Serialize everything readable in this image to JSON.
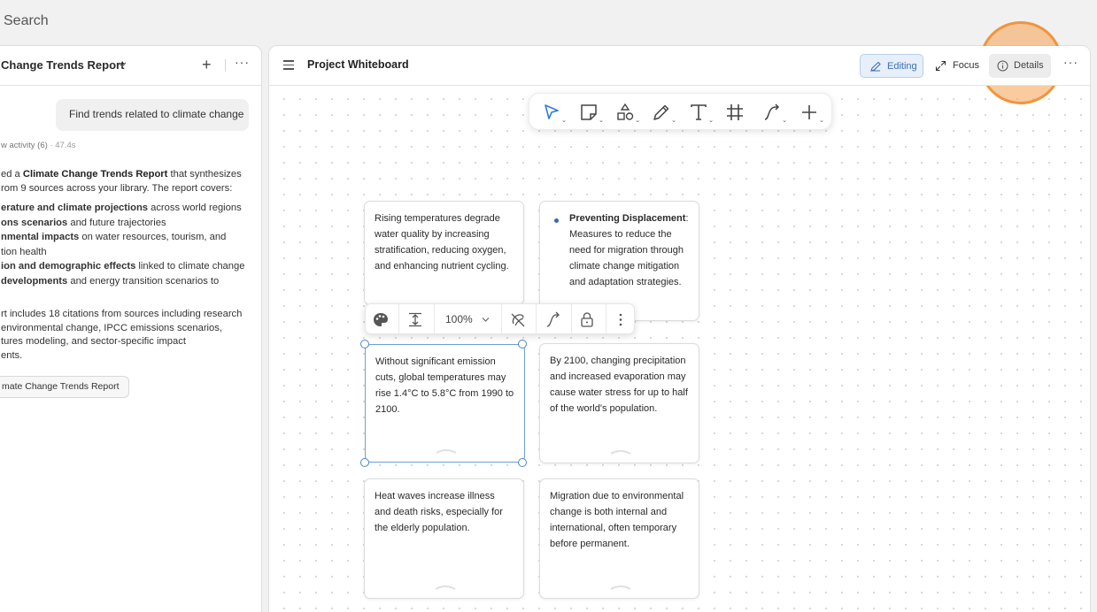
{
  "topbar": {
    "search_label": "Search"
  },
  "left_panel": {
    "report_title": "Change Trends Report",
    "user_message": "Find trends related to climate change",
    "activity": {
      "label": "w activity (6)",
      "time": " · 47.4s"
    },
    "answer_lines": [
      [
        "ed a ",
        "Climate Change Trends Report",
        " that synthesizes"
      ],
      [
        "rom 9 sources across your library. The report covers:",
        "",
        ""
      ]
    ],
    "bullets": [
      [
        "erature and climate projections",
        " across world regions"
      ],
      [
        "ons scenarios",
        " and future trajectories"
      ],
      [
        "nmental impacts",
        " on water resources, tourism, and"
      ],
      [
        "",
        "tion health"
      ],
      [
        "ion and demographic effects",
        " linked to climate change"
      ],
      [
        "developments",
        " and energy transition scenarios to"
      ]
    ],
    "citations": [
      "rt includes 18 citations from sources including research",
      " environmental change, IPCC emissions scenarios,",
      "tures modeling, and sector-specific impact",
      "ents."
    ],
    "report_chip": "mate Change Trends Report"
  },
  "main": {
    "title": "Project Whiteboard",
    "editing_label": "Editing",
    "focus_label": "Focus",
    "details_label": "Details",
    "zoom": "100%",
    "cards": [
      {
        "text": "Rising temperatures degrade water quality by increasing stratification, reducing oxygen, and enhancing nutrient cycling."
      },
      {
        "bold": "Preventing Displacement",
        "text": ": Measures to reduce the need for migration through climate change mitigation and adaptation strategies."
      },
      {
        "text": "Without significant emission cuts, global temperatures may rise 1.4°C to 5.8°C from 1990 to 2100."
      },
      {
        "text": "By 2100, changing precipitation and increased evaporation may cause water stress for up to half of the world's population."
      },
      {
        "text": "Heat waves increase illness and death risks, especially for the elderly population."
      },
      {
        "text": "Migration due to environmental change is both internal and international, often temporary before permanent."
      }
    ]
  },
  "colors": {
    "accent": "#4a86c8",
    "highlight": "#f0953d"
  }
}
